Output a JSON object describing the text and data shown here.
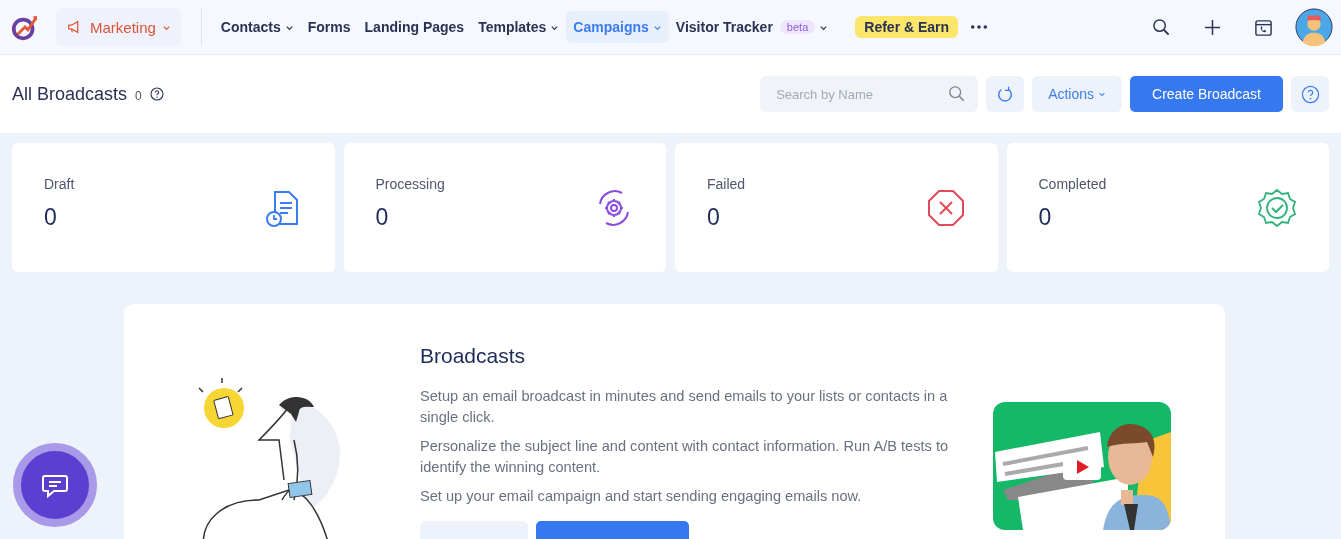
{
  "nav": {
    "module": {
      "label": "Marketing"
    },
    "items": [
      {
        "label": "Contacts",
        "dropdown": true,
        "selected": false
      },
      {
        "label": "Forms",
        "dropdown": false,
        "selected": false
      },
      {
        "label": "Landing Pages",
        "dropdown": false,
        "selected": false
      },
      {
        "label": "Templates",
        "dropdown": true,
        "selected": false
      },
      {
        "label": "Campaigns",
        "dropdown": true,
        "selected": true
      },
      {
        "label": "Visitor Tracker",
        "badge": "beta",
        "dropdown": true,
        "selected": false
      }
    ],
    "promo": "Refer & Earn"
  },
  "header": {
    "title": "All Broadcasts",
    "count": "0",
    "search": {
      "placeholder": "Search by Name"
    },
    "actions": "Actions",
    "create": "Create Broadcast"
  },
  "stats": [
    {
      "kind": "draft",
      "label": "Draft",
      "value": "0"
    },
    {
      "kind": "processing",
      "label": "Processing",
      "value": "0"
    },
    {
      "kind": "failed",
      "label": "Failed",
      "value": "0"
    },
    {
      "kind": "completed",
      "label": "Completed",
      "value": "0"
    }
  ],
  "intro": {
    "title": "Broadcasts",
    "paragraphs": [
      "Setup an email broadcast in minutes and send emails to your lists or contacts in a single click.",
      "Personalize the subject line and content with contact information. Run A/B tests to identify the winning content.",
      "Set up your email campaign and start sending engaging emails now."
    ],
    "video": {
      "kind": "picture"
    }
  }
}
